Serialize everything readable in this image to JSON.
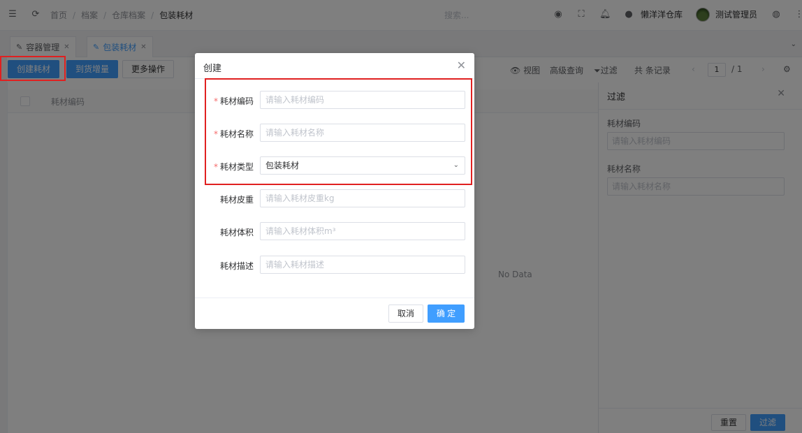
{
  "topbar": {
    "breadcrumb": [
      "首页",
      "档案",
      "仓库档案",
      "包装耗材"
    ],
    "search_placeholder": "搜索...",
    "warehouse": "懒洋洋仓库",
    "user": "测试管理员"
  },
  "tabs": [
    {
      "label": "容器管理"
    },
    {
      "label": "包装耗材"
    }
  ],
  "toolbar": {
    "create_label": "创建耗材",
    "arrival_label": "到货增量",
    "more_label": "更多操作",
    "view_label": "视图",
    "advanced_query_label": "高级查询",
    "filter_label": "过滤",
    "records_label": "共 条记录",
    "page_current": "1",
    "page_total": "/ 1"
  },
  "table": {
    "header": "耗材编码",
    "empty_text": "No Data"
  },
  "filter_panel": {
    "title": "过滤",
    "fields": [
      {
        "label": "耗材编码",
        "placeholder": "请输入耗材编码"
      },
      {
        "label": "耗材名称",
        "placeholder": "请输入耗材名称"
      }
    ],
    "reset_label": "重置",
    "filter_label": "过滤"
  },
  "dialog": {
    "title": "创建",
    "fields": [
      {
        "label": "耗材编码",
        "required": true,
        "placeholder": "请输入耗材编码"
      },
      {
        "label": "耗材名称",
        "required": true,
        "placeholder": "请输入耗材名称"
      },
      {
        "label": "耗材类型",
        "required": true,
        "value": "包装耗材"
      },
      {
        "label": "耗材皮重",
        "required": false,
        "placeholder": "请输入耗材皮重kg"
      },
      {
        "label": "耗材体积",
        "required": false,
        "placeholder": "请输入耗材体积m³"
      },
      {
        "label": "耗材描述",
        "required": false,
        "placeholder": "请输入耗材描述"
      }
    ],
    "required_mark": "*",
    "cancel_label": "取消",
    "confirm_label": "确 定"
  },
  "colors": {
    "primary": "#409eff",
    "highlight": "#e02020",
    "required": "#f56c6c"
  }
}
